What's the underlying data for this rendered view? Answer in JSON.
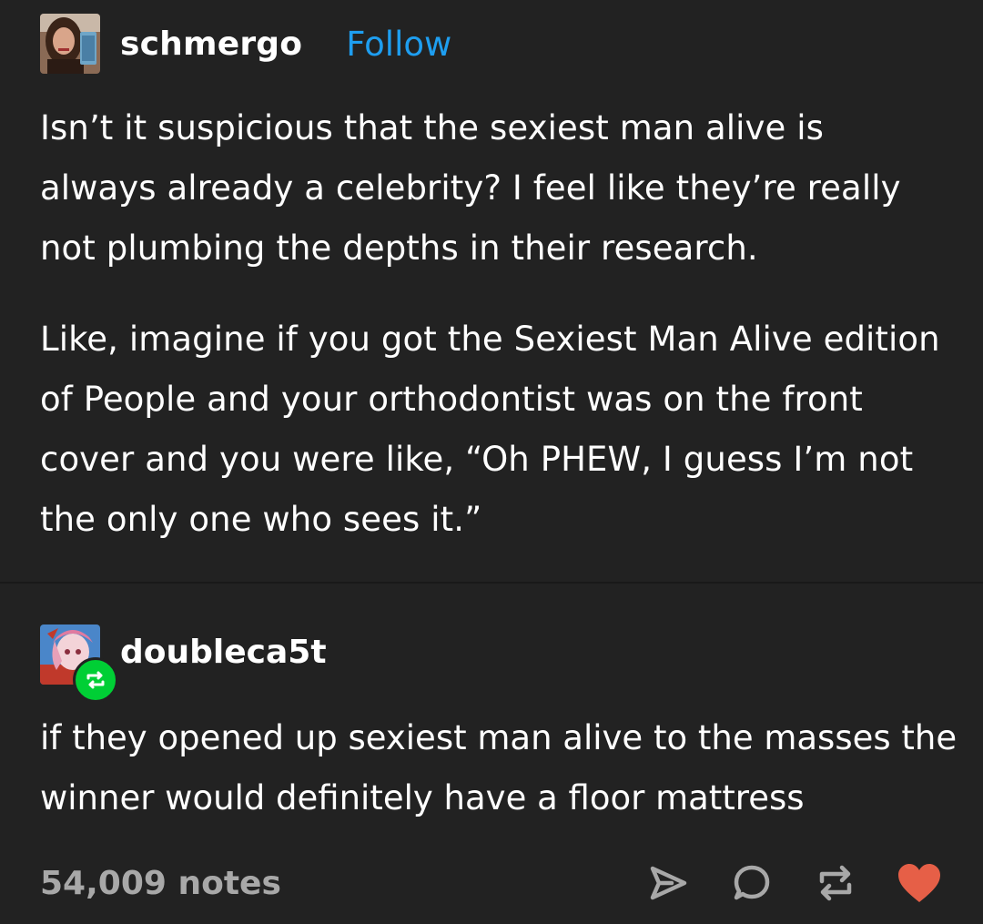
{
  "post": {
    "username": "schmergo",
    "follow_label": "Follow",
    "paragraphs": [
      "Isn’t it suspicious that the sexiest man alive is always already a celebrity? I feel like they’re really not plumbing the depths in their research.",
      "Like, imagine if you got the Sexiest Man Alive edition of People and your orthodontist was on the front cover and you were like, “Oh PHEW, I guess I’m not the only one who sees it.”"
    ]
  },
  "reblog": {
    "username": "doubleca5t",
    "text": "if they opened up sexiest man alive to the masses the winner would definitely have a floor mattress"
  },
  "footer": {
    "notes": "54,009 notes",
    "actions": [
      "share-icon",
      "reply-icon",
      "reblog-icon",
      "like-icon"
    ]
  },
  "colors": {
    "background": "#222222",
    "text": "#ffffff",
    "follow": "#1e9ef0",
    "notes": "#a8a8a8",
    "reblog_badge": "#00cf35",
    "like": "#e65f47"
  }
}
